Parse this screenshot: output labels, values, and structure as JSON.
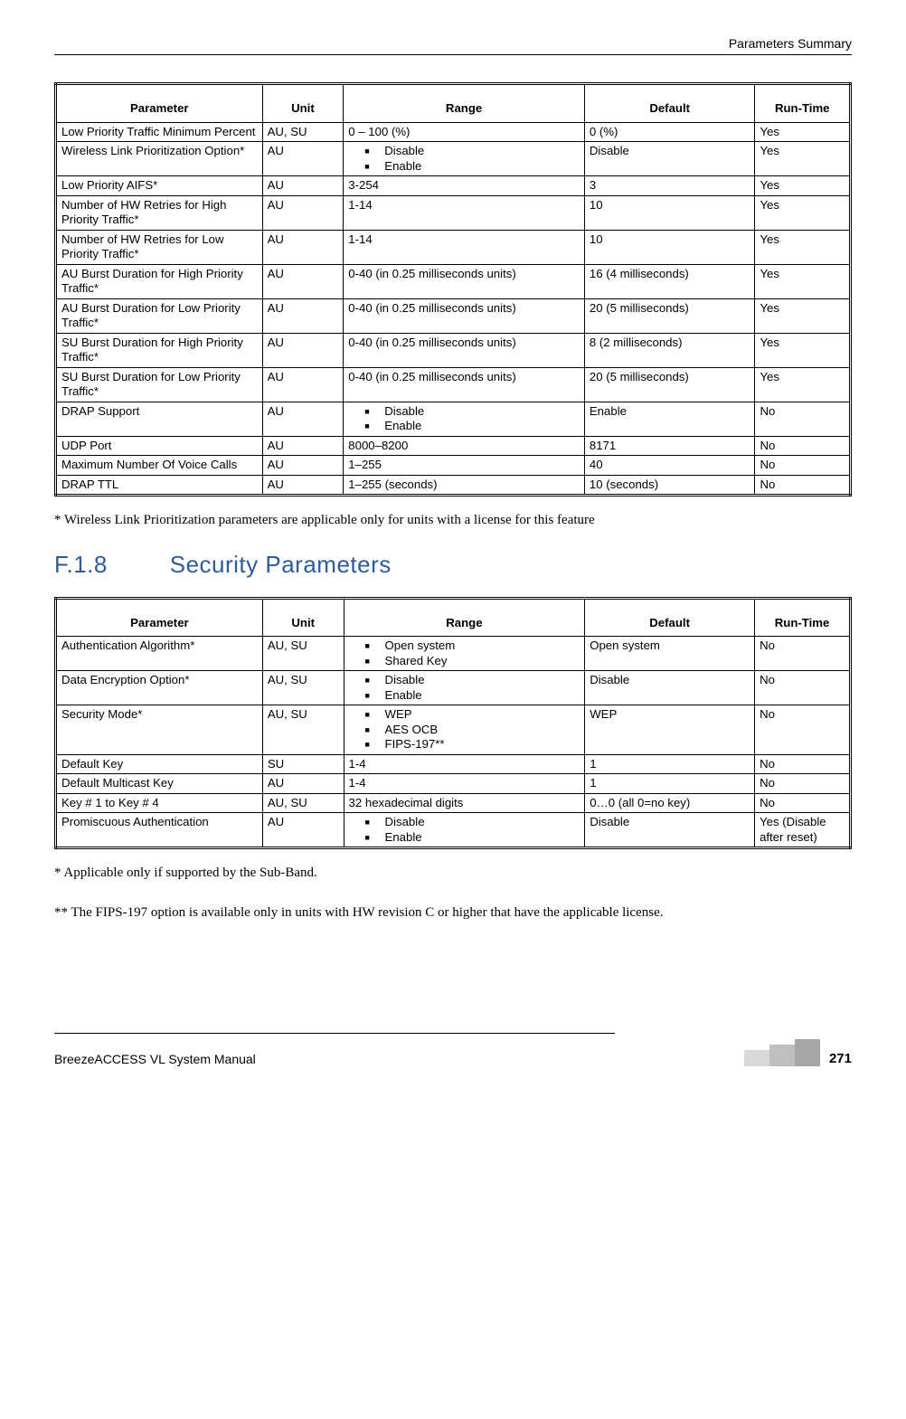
{
  "header": {
    "right": "Parameters Summary"
  },
  "table1": {
    "headers": [
      "Parameter",
      "Unit",
      "Range",
      "Default",
      "Run-Time"
    ],
    "rows": [
      {
        "param": "Low Priority Traffic Minimum Percent",
        "unit": "AU, SU",
        "range": "0 – 100 (%)",
        "default": "0 (%)",
        "runtime": "Yes"
      },
      {
        "param": "Wireless Link Prioritization Option*",
        "unit": "AU",
        "range_list": [
          "Disable",
          "Enable"
        ],
        "default": "Disable",
        "runtime": "Yes"
      },
      {
        "param": "Low Priority AIFS*",
        "unit": "AU",
        "range": "3-254",
        "default": "3",
        "runtime": "Yes"
      },
      {
        "param": "Number of HW Retries for High Priority Traffic*",
        "unit": "AU",
        "range": "1-14",
        "default": "10",
        "runtime": "Yes"
      },
      {
        "param": "Number of HW Retries for Low Priority Traffic*",
        "unit": "AU",
        "range": "1-14",
        "default": "10",
        "runtime": "Yes"
      },
      {
        "param": "AU Burst Duration for High Priority Traffic*",
        "unit": "AU",
        "range": "0-40 (in 0.25 milliseconds units)",
        "default": "16 (4 milliseconds)",
        "runtime": "Yes"
      },
      {
        "param": "AU Burst Duration for Low Priority Traffic*",
        "unit": "AU",
        "range": "0-40 (in 0.25 milliseconds units)",
        "default": "20 (5 milliseconds)",
        "runtime": "Yes"
      },
      {
        "param": "SU Burst Duration for High Priority Traffic*",
        "unit": "AU",
        "range": "0-40 (in 0.25 milliseconds units)",
        "default": "8 (2 milliseconds)",
        "runtime": "Yes"
      },
      {
        "param": "SU Burst Duration for Low Priority Traffic*",
        "unit": "AU",
        "range": "0-40 (in 0.25 milliseconds units)",
        "default": "20 (5 milliseconds)",
        "runtime": "Yes"
      },
      {
        "param": "DRAP Support",
        "unit": "AU",
        "range_list": [
          "Disable",
          "Enable"
        ],
        "default": "Enable",
        "runtime": "No"
      },
      {
        "param": "UDP Port",
        "unit": "AU",
        "range": "8000–8200",
        "default": "8171",
        "runtime": "No"
      },
      {
        "param": "Maximum Number Of Voice Calls",
        "unit": "AU",
        "range": "1–255",
        "default": "40",
        "runtime": "No"
      },
      {
        "param": "DRAP TTL",
        "unit": "AU",
        "range": "1–255 (seconds)",
        "default": "10 (seconds)",
        "runtime": "No"
      }
    ]
  },
  "note1": "* Wireless Link Prioritization parameters are applicable only for units with a license for this feature",
  "section": {
    "number": "F.1.8",
    "title": "Security Parameters"
  },
  "table2": {
    "headers": [
      "Parameter",
      "Unit",
      "Range",
      "Default",
      "Run-Time"
    ],
    "rows": [
      {
        "param": "Authentication Algorithm*",
        "unit": "AU, SU",
        "range_list": [
          "Open system",
          "Shared Key"
        ],
        "default": "Open system",
        "runtime": "No"
      },
      {
        "param": "Data Encryption Option*",
        "unit": "AU, SU",
        "range_list": [
          "Disable",
          "Enable"
        ],
        "default": "Disable",
        "runtime": "No"
      },
      {
        "param": "Security Mode*",
        "unit": "AU, SU",
        "range_list": [
          "WEP",
          "AES OCB",
          "FIPS-197**"
        ],
        "default": "WEP",
        "runtime": "No"
      },
      {
        "param": "Default Key",
        "unit": "SU",
        "range": "1-4",
        "default": "1",
        "runtime": "No"
      },
      {
        "param": "Default Multicast Key",
        "unit": "AU",
        "range": "1-4",
        "default": "1",
        "runtime": "No"
      },
      {
        "param": "Key # 1 to Key # 4",
        "unit": "AU, SU",
        "range": "32 hexadecimal digits",
        "default": "0…0 (all 0=no key)",
        "runtime": "No"
      },
      {
        "param": "Promiscuous Authentication",
        "unit": "AU",
        "range_list": [
          "Disable",
          "Enable"
        ],
        "default": "Disable",
        "runtime": "Yes (Disable after reset)"
      }
    ]
  },
  "note2": "* Applicable only if supported by the Sub-Band.",
  "note3": "** The FIPS-197 option is available only in units with HW revision C or higher that have the applicable license.",
  "footer": {
    "left": "BreezeACCESS VL System Manual",
    "right": "271"
  }
}
